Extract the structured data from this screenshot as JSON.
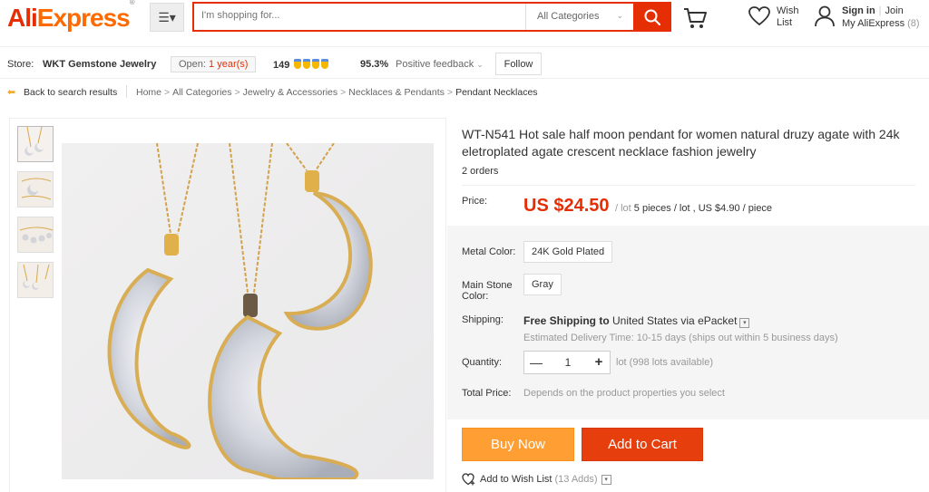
{
  "header": {
    "logo_part1": "Ali",
    "logo_part2": "Express",
    "logo_tm": "®",
    "search_placeholder": "I'm shopping for...",
    "category": "All Categories",
    "wish_line1": "Wish",
    "wish_line2": "List",
    "signin": "Sign in",
    "join": "Join",
    "my_account": "My AliExpress",
    "my_account_count": "(8)"
  },
  "store": {
    "label": "Store:",
    "name": "WKT Gemstone Jewelry",
    "open_label": "Open:",
    "open_years": "1 year(s)",
    "score": "149",
    "feedback_pct": "95.3%",
    "feedback_label": "Positive feedback",
    "follow": "Follow"
  },
  "breadcrumb": {
    "back": "Back to search results",
    "path": [
      "Home",
      "All Categories",
      "Jewelry & Accessories",
      "Necklaces & Pendants",
      "Pendant Necklaces"
    ]
  },
  "product": {
    "title": "WT-N541 Hot sale half moon pendant for women natural druzy agate with 24k eletroplated agate crescent necklace fashion jewelry",
    "orders": "2 orders",
    "price_label": "Price:",
    "price": "US $24.50",
    "price_per": "/ lot",
    "price_detail": "5 pieces / lot , US $4.90 / piece",
    "metal_label": "Metal Color:",
    "metal_value": "24K Gold Plated",
    "stone_label_1": "Main Stone",
    "stone_label_2": "Color:",
    "stone_value": "Gray",
    "shipping_label": "Shipping:",
    "shipping_free": "Free Shipping to",
    "shipping_dest": "United States via ePacket",
    "delivery": "Estimated Delivery Time: 10-15 days (ships out within 5 business days)",
    "qty_label": "Quantity:",
    "qty_minus": "—",
    "qty_value": "1",
    "qty_plus": "+",
    "availability": "lot (998 lots available)",
    "total_label": "Total Price:",
    "total_text": "Depends on the product properties you select",
    "buy_now": "Buy Now",
    "add_to_cart": "Add to Cart",
    "wishlist": "Add to Wish List",
    "wishlist_count": "(13 Adds)"
  },
  "colors": {
    "brand_red": "#e62e04",
    "buy_orange": "#ff9e33",
    "cart_red": "#e63e0d"
  },
  "icons": [
    "menu-icon",
    "search-icon",
    "cart-icon",
    "heart-icon",
    "user-icon",
    "back-arrow-icon",
    "chevron-down-icon",
    "medal-icon"
  ]
}
